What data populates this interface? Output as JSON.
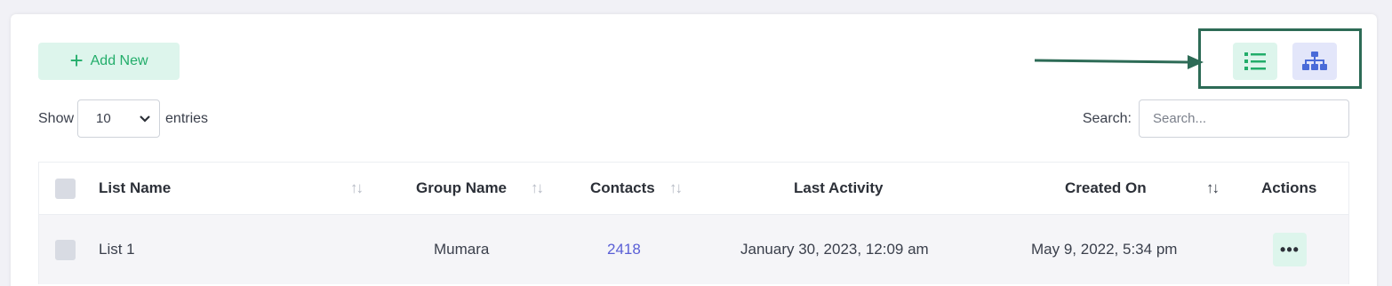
{
  "toolbar": {
    "add_new_label": "Add New",
    "plus_icon_glyph": "+"
  },
  "view_toggle": {
    "list_icon": "list-icon",
    "tree_icon": "sitemap-icon",
    "accent": "#2d6b56"
  },
  "entries": {
    "show_label": "Show",
    "selected": "10",
    "entries_label": "entries"
  },
  "search": {
    "label": "Search:",
    "placeholder": "Search..."
  },
  "table": {
    "columns": {
      "list_name": "List Name",
      "group_name": "Group Name",
      "contacts": "Contacts",
      "last_activity": "Last Activity",
      "created_on": "Created On",
      "actions": "Actions"
    },
    "sort_glyph": "↑↓",
    "rows": [
      {
        "list_name": "List 1",
        "group_name": "Mumara",
        "contacts": "2418",
        "last_activity": "January 30, 2023, 12:09 am",
        "created_on": "May 9, 2022, 5:34 pm",
        "actions": "•••"
      }
    ]
  },
  "colors": {
    "brand_green": "#22ad6a",
    "brand_green_bg": "#ddf5ec",
    "link_blue": "#5a5fd6",
    "tree_blue": "#4a6bd8"
  }
}
